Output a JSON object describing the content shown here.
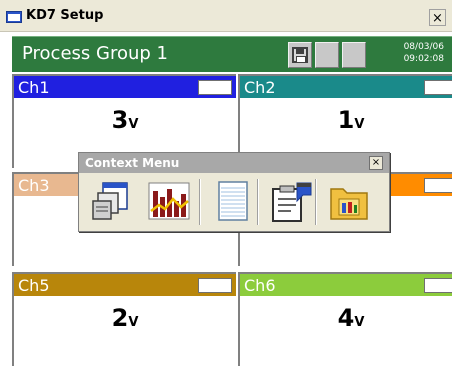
{
  "window": {
    "title": "KD7 Setup",
    "close_glyph": "×"
  },
  "header": {
    "group_name": "Process Group 1",
    "date": "08/03/06",
    "time": "09:02:08",
    "background_color": "#2e7a3e"
  },
  "channels": [
    {
      "label": "Ch1",
      "value": "3",
      "unit": "V",
      "color": "#2020e0"
    },
    {
      "label": "Ch2",
      "value": "1",
      "unit": "V",
      "color": "#1a8a8a"
    },
    {
      "label": "Ch3",
      "value": "",
      "unit": "",
      "color": "#e8b890"
    },
    {
      "label": "",
      "value": "",
      "unit": "",
      "color": "#ff8c00"
    },
    {
      "label": "Ch5",
      "value": "2",
      "unit": "V",
      "color": "#b8860b"
    },
    {
      "label": "Ch6",
      "value": "4",
      "unit": "V",
      "color": "#8ccc3c"
    }
  ],
  "context_menu": {
    "title": "Context Menu",
    "close_glyph": "×",
    "items": [
      {
        "icon": "window-cascade-icon"
      },
      {
        "icon": "bar-chart-icon"
      },
      {
        "icon": "notepad-icon"
      },
      {
        "icon": "clipboard-edit-icon"
      },
      {
        "icon": "folder-tools-icon"
      }
    ]
  }
}
